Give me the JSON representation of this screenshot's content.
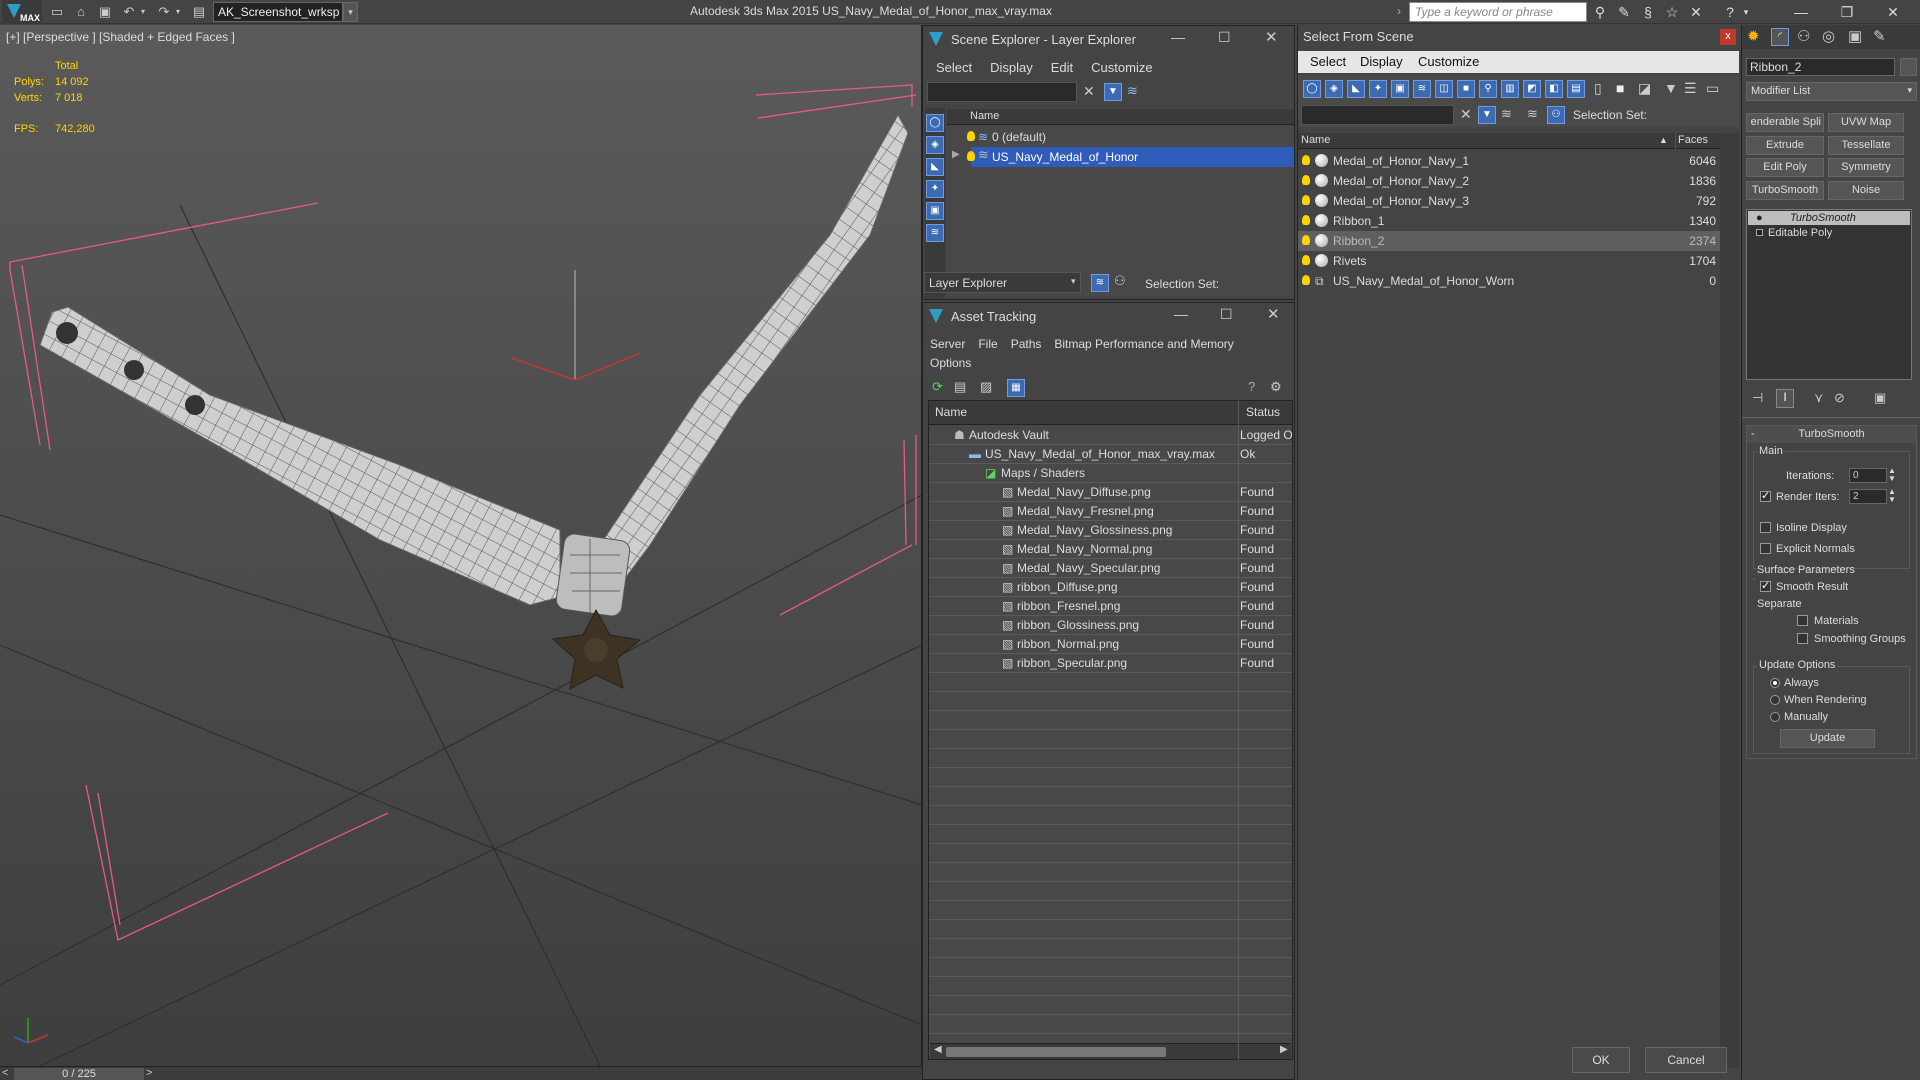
{
  "titlebar": {
    "logo_text": "MAX",
    "workspace": "AK_Screenshot_wrksp",
    "app_title": "Autodesk 3ds Max  2015    US_Navy_Medal_of_Honor_max_vray.max",
    "search_placeholder": "Type a keyword or phrase"
  },
  "viewport": {
    "label": "[+] [Perspective ] [Shaded + Edged Faces ]",
    "total_label": "Total",
    "polys_label": "Polys:",
    "polys_value": "14 092",
    "verts_label": "Verts:",
    "verts_value": "7 018",
    "fps_label": "FPS:",
    "fps_value": "742,280"
  },
  "timeline": {
    "prev": "<",
    "frame": "0 / 225",
    "next": ">"
  },
  "scene_explorer": {
    "title": "Scene Explorer - Layer Explorer",
    "menu": [
      "Select",
      "Display",
      "Edit",
      "Customize"
    ],
    "column_name": "Name",
    "layers": [
      {
        "name": "0 (default)",
        "selected": false
      },
      {
        "name": "US_Navy_Medal_of_Honor",
        "selected": true
      }
    ],
    "footer_dropdown": "Layer Explorer",
    "selection_set_label": "Selection Set:"
  },
  "asset_tracking": {
    "title": "Asset Tracking",
    "menu": [
      "Server",
      "File",
      "Paths",
      "Bitmap Performance and Memory",
      "Options"
    ],
    "col_name": "Name",
    "col_status": "Status",
    "rows": [
      {
        "name": "Autodesk Vault",
        "status": "Logged O",
        "indent": 1
      },
      {
        "name": "US_Navy_Medal_of_Honor_max_vray.max",
        "status": "Ok",
        "indent": 2
      },
      {
        "name": "Maps / Shaders",
        "status": "",
        "indent": 3
      },
      {
        "name": "Medal_Navy_Diffuse.png",
        "status": "Found",
        "indent": 4
      },
      {
        "name": "Medal_Navy_Fresnel.png",
        "status": "Found",
        "indent": 4
      },
      {
        "name": "Medal_Navy_Glossiness.png",
        "status": "Found",
        "indent": 4
      },
      {
        "name": "Medal_Navy_Normal.png",
        "status": "Found",
        "indent": 4
      },
      {
        "name": "Medal_Navy_Specular.png",
        "status": "Found",
        "indent": 4
      },
      {
        "name": "ribbon_Diffuse.png",
        "status": "Found",
        "indent": 4
      },
      {
        "name": "ribbon_Fresnel.png",
        "status": "Found",
        "indent": 4
      },
      {
        "name": "ribbon_Glossiness.png",
        "status": "Found",
        "indent": 4
      },
      {
        "name": "ribbon_Normal.png",
        "status": "Found",
        "indent": 4
      },
      {
        "name": "ribbon_Specular.png",
        "status": "Found",
        "indent": 4
      }
    ]
  },
  "select_from_scene": {
    "title": "Select From Scene",
    "close": "x",
    "menu": [
      "Select",
      "Display",
      "Customize"
    ],
    "selection_set_label": "Selection Set:",
    "col_name": "Name",
    "col_faces": "Faces",
    "sort_indicator": "▲",
    "objects": [
      {
        "name": "Medal_of_Honor_Navy_1",
        "faces": "6046"
      },
      {
        "name": "Medal_of_Honor_Navy_2",
        "faces": "1836"
      },
      {
        "name": "Medal_of_Honor_Navy_3",
        "faces": "792"
      },
      {
        "name": "Ribbon_1",
        "faces": "1340"
      },
      {
        "name": "Ribbon_2",
        "faces": "2374"
      },
      {
        "name": "Rivets",
        "faces": "1704"
      },
      {
        "name": "US_Navy_Medal_of_Honor_Worn",
        "faces": "0"
      }
    ],
    "highlighted_row": "Ribbon_2",
    "ok": "OK",
    "cancel": "Cancel"
  },
  "command_panel": {
    "object_name": "Ribbon_2",
    "modifier_list": "Modifier List",
    "buttons": [
      "enderable Spli",
      "UVW Map",
      "Extrude",
      "Tessellate",
      "Edit Poly",
      "Symmetry",
      "TurboSmooth",
      "Noise"
    ],
    "stack": [
      "TurboSmooth",
      "Editable Poly"
    ],
    "rollout_title": "TurboSmooth",
    "minus": "-",
    "main_label": "Main",
    "iterations_label": "Iterations:",
    "iterations_value": "0",
    "render_iters_label": "Render Iters:",
    "render_iters_value": "2",
    "isoline_label": "Isoline Display",
    "explicit_normals_label": "Explicit Normals",
    "surface_params_label": "Surface Parameters",
    "smooth_result_label": "Smooth Result",
    "separate_label": "Separate",
    "materials_label": "Materials",
    "smoothing_groups_label": "Smoothing Groups",
    "update_options_label": "Update Options",
    "always_label": "Always",
    "when_rendering_label": "When Rendering",
    "manually_label": "Manually",
    "update_button": "Update"
  },
  "colors": {
    "selection_blue": "#2e5cb8",
    "stat_yellow": "#ffd500",
    "bounding_pink": "#e8578f"
  }
}
